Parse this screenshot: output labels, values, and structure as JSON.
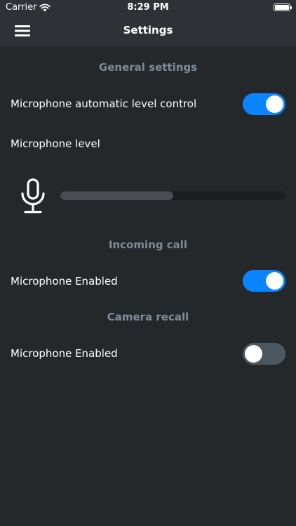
{
  "status_bar": {
    "carrier": "Carrier",
    "time": "8:29 PM",
    "battery_icon": "battery-full-icon",
    "wifi_icon": "wifi-icon"
  },
  "nav": {
    "title": "Settings",
    "menu_icon": "hamburger-menu-icon"
  },
  "general": {
    "section_title": "General settings",
    "auto_level_label": "Microphone automatic level control",
    "auto_level_on": true,
    "mic_level_label": "Microphone level",
    "mic_level_value": 0.5,
    "mic_icon": "microphone-icon"
  },
  "incoming_call": {
    "section_title": "Incoming call",
    "mic_enabled_label": "Microphone Enabled",
    "mic_enabled_on": true
  },
  "camera_recall": {
    "section_title": "Camera recall",
    "mic_enabled_label": "Microphone Enabled",
    "mic_enabled_on": false
  },
  "colors": {
    "background": "#25282b",
    "topbar": "#2e3135",
    "accent": "#0a84ff",
    "section_title": "#7d8c99",
    "toggle_off": "#4b5862"
  }
}
